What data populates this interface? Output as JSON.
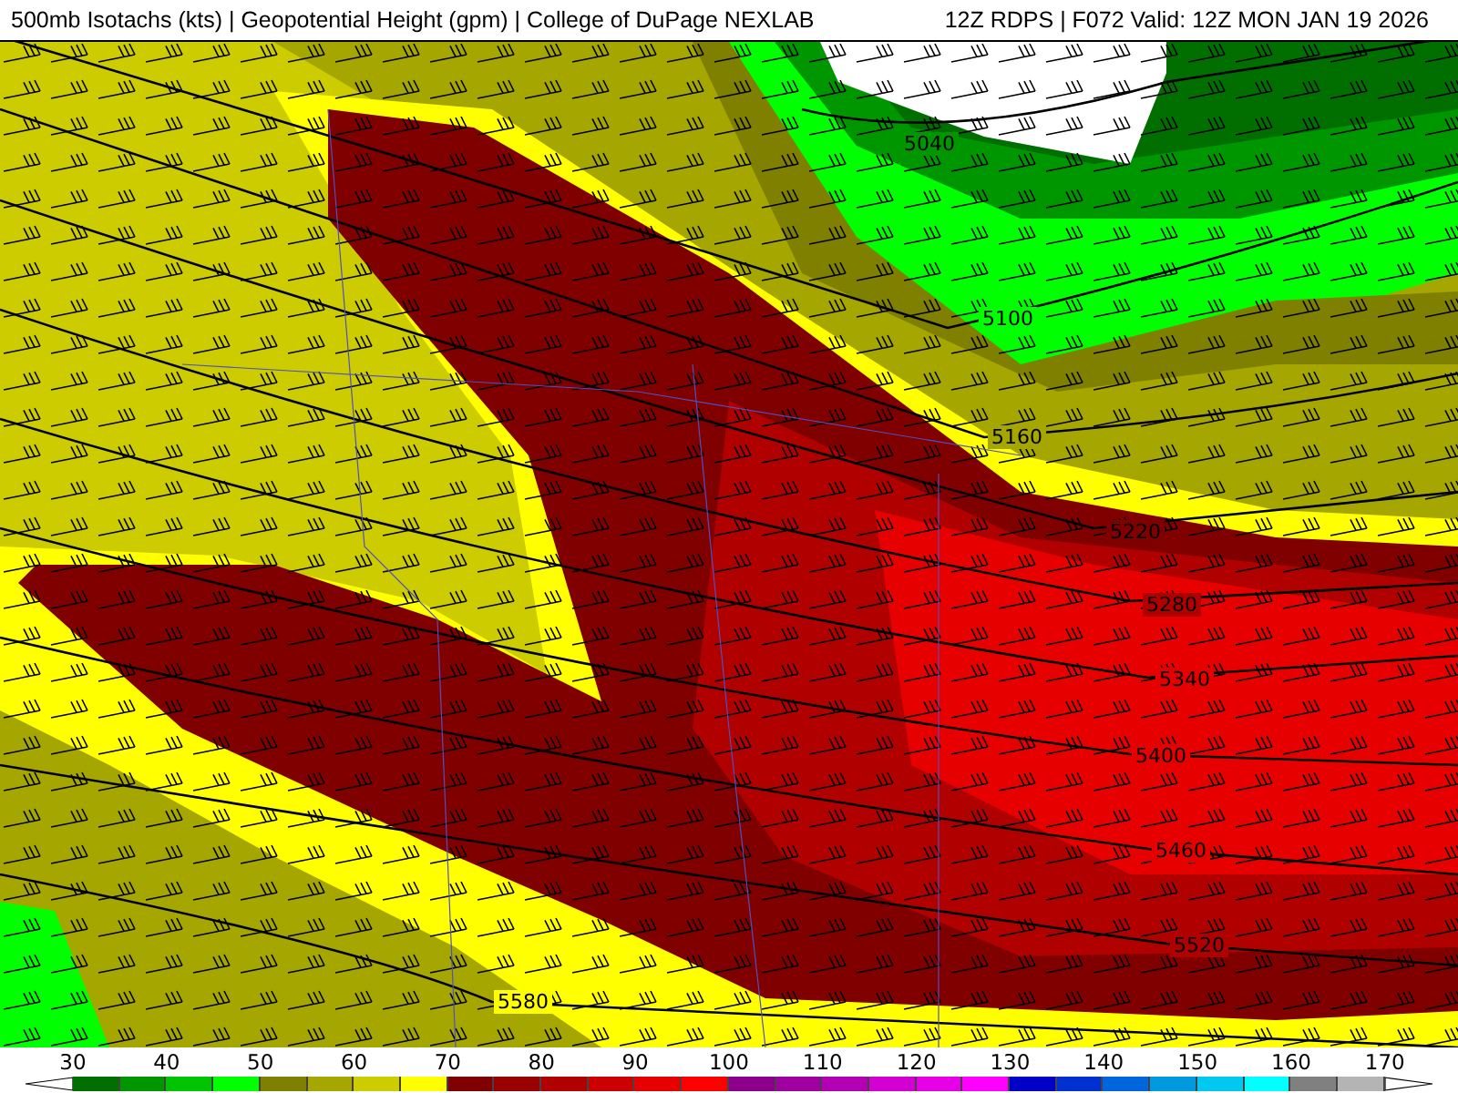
{
  "header": {
    "title": "500mb Isotachs (kts) | Geopotential Height (gpm) | College of DuPage NEXLAB",
    "run": "12Z RDPS | F072 Valid: 12Z MON JAN 19 2026"
  },
  "map": {
    "contour_labels": [
      "5040",
      "5100",
      "5160",
      "5220",
      "5280",
      "5340",
      "5400",
      "5460",
      "5520",
      "5580"
    ]
  },
  "legend": {
    "ticks": [
      "30",
      "40",
      "50",
      "60",
      "70",
      "80",
      "90",
      "100",
      "110",
      "120",
      "130",
      "140",
      "150",
      "160",
      "170"
    ],
    "swatches": [
      {
        "color": "#006f00"
      },
      {
        "color": "#009600"
      },
      {
        "color": "#00c400"
      },
      {
        "color": "#00ff00"
      },
      {
        "color": "#7f7f00"
      },
      {
        "color": "#a6a600"
      },
      {
        "color": "#cccc00"
      },
      {
        "color": "#ffff00"
      },
      {
        "color": "#800000"
      },
      {
        "color": "#990000"
      },
      {
        "color": "#b00000"
      },
      {
        "color": "#cc0000"
      },
      {
        "color": "#e60000"
      },
      {
        "color": "#ff0000"
      },
      {
        "color": "#8c008c"
      },
      {
        "color": "#a000a0"
      },
      {
        "color": "#b400b4"
      },
      {
        "color": "#d200d2"
      },
      {
        "color": "#e600e6"
      },
      {
        "color": "#ff00ff"
      },
      {
        "color": "#0000c8"
      },
      {
        "color": "#0030d0"
      },
      {
        "color": "#0066dd"
      },
      {
        "color": "#0099e0"
      },
      {
        "color": "#00c8f0"
      },
      {
        "color": "#00ffff"
      },
      {
        "color": "#808080"
      },
      {
        "color": "#b4b4b4"
      }
    ]
  }
}
